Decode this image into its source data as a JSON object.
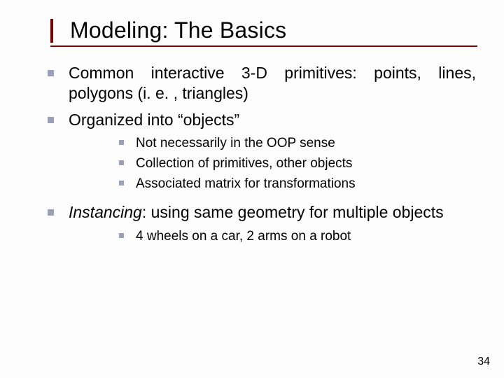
{
  "title": "Modeling: The Basics",
  "bullets": {
    "b1": "Common interactive 3-D primitives: points, lines, polygons (i. e. , triangles)",
    "b2": "Organized into “objects”",
    "b2_sub": {
      "s1": "Not necessarily in the OOP sense",
      "s2": "Collection of primitives, other objects",
      "s3": "Associated matrix for transformations"
    },
    "b3_prefix_italic": "Instancing",
    "b3_rest": ": using same geometry for multiple objects",
    "b3_sub": {
      "s1": "4 wheels on a car, 2 arms on a robot"
    }
  },
  "page_number": "34"
}
